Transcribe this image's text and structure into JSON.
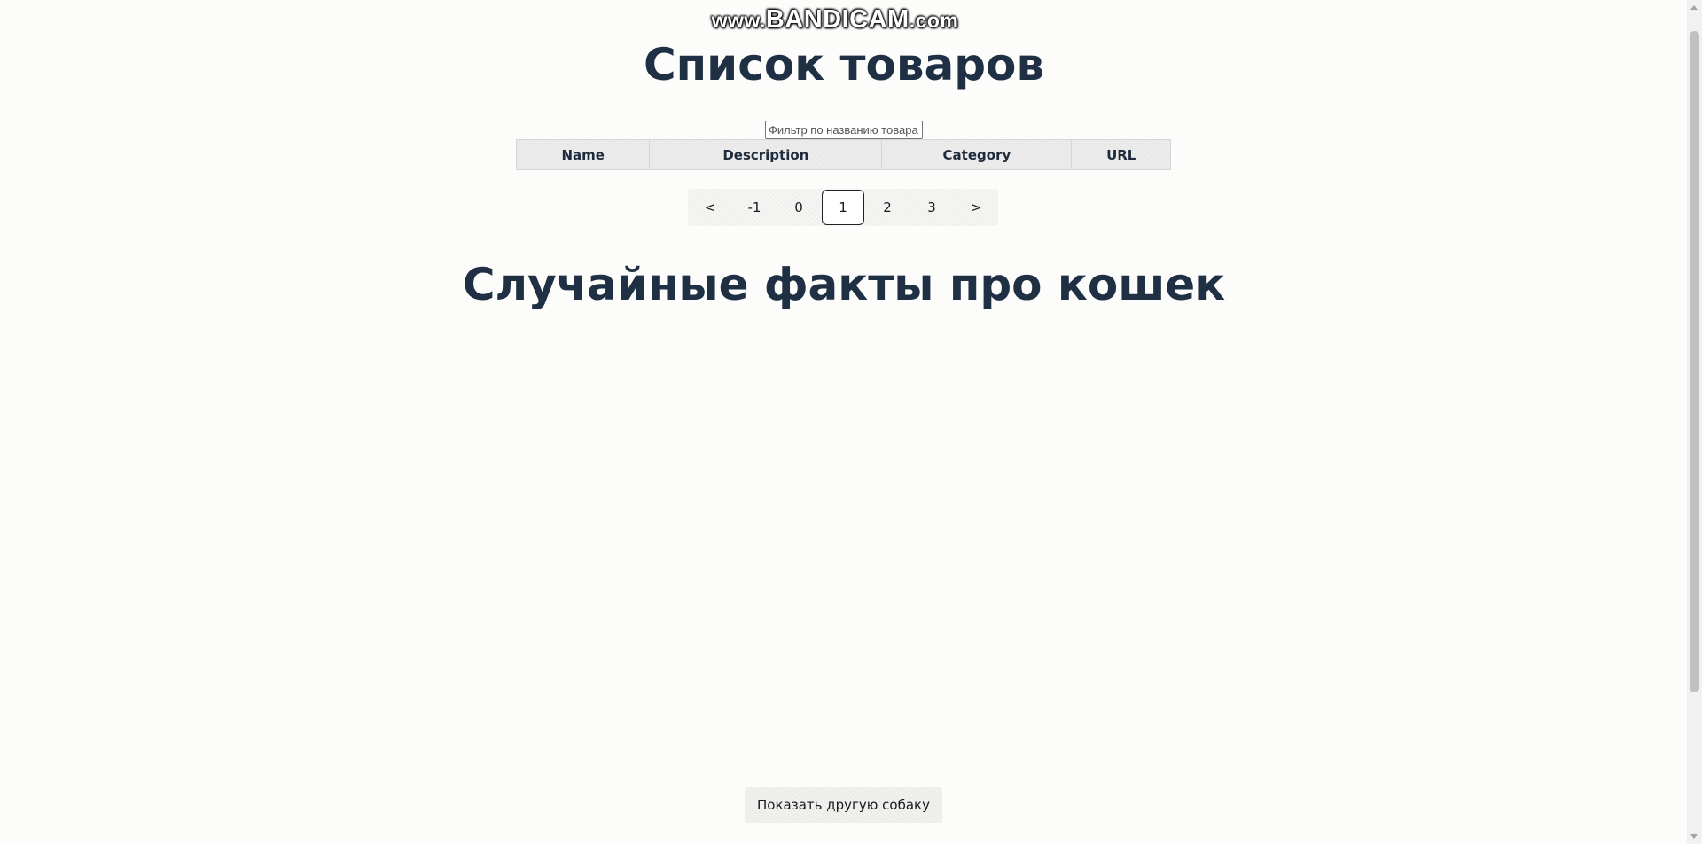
{
  "watermark": {
    "prefix": "www.",
    "brand": "BANDICAM",
    "suffix": ".com"
  },
  "products": {
    "title": "Список товаров",
    "filter_placeholder": "Фильтр по названию товара",
    "filter_value": "",
    "columns": [
      "Name",
      "Description",
      "Category",
      "URL"
    ]
  },
  "pagination": {
    "prev": "<",
    "next": ">",
    "pages": [
      "-1",
      "0",
      "1",
      "2",
      "3"
    ],
    "current": "1"
  },
  "cats": {
    "title": "Случайные факты про кошек"
  },
  "dog": {
    "button_label": "Показать другую собаку"
  }
}
